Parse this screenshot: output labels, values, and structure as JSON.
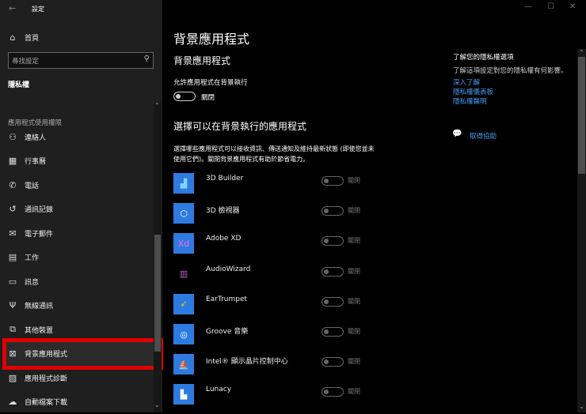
{
  "window": {
    "title": "設定",
    "minimize": "—",
    "maximize": "☐",
    "close": "✕"
  },
  "sidebar": {
    "home": "首頁",
    "search_placeholder": "尋找設定",
    "section": "隱私權",
    "group": "應用程式使用權限",
    "items": [
      {
        "label": "連絡人",
        "icon": "contacts-icon",
        "glyph": "⚇"
      },
      {
        "label": "行事曆",
        "icon": "calendar-icon",
        "glyph": "▦"
      },
      {
        "label": "電話",
        "icon": "phone-icon",
        "glyph": "✆"
      },
      {
        "label": "通訊記錄",
        "icon": "history-icon",
        "glyph": "↺"
      },
      {
        "label": "電子郵件",
        "icon": "mail-icon",
        "glyph": "✉"
      },
      {
        "label": "工作",
        "icon": "clipboard-icon",
        "glyph": "▤"
      },
      {
        "label": "訊息",
        "icon": "message-icon",
        "glyph": "▭"
      },
      {
        "label": "無線通訊",
        "icon": "radio-icon",
        "glyph": "Ψ"
      },
      {
        "label": "其他裝置",
        "icon": "devices-icon",
        "glyph": "⧉"
      },
      {
        "label": "背景應用程式",
        "icon": "background-apps-icon",
        "glyph": "⊠"
      },
      {
        "label": "應用程式診斷",
        "icon": "diagnostics-icon",
        "glyph": "▨"
      },
      {
        "label": "自動檔案下載",
        "icon": "cloud-icon",
        "glyph": "☁"
      }
    ]
  },
  "main": {
    "title": "背景應用程式",
    "subtitle": "背景應用程式",
    "allow_label": "允許應用程式在背景執行",
    "allow_state": "關閉",
    "choose_heading": "選擇可以在背景執行的應用程式",
    "desc1": "選擇哪些應用程式可以接收資訊、傳送通知及維持最新狀態 (即使您並未",
    "desc2": "使用它們)。關閉背景應用程式有助於節省電力。",
    "apps": [
      {
        "name": "3D Builder",
        "state": "關閉",
        "bg": "#2d7be0",
        "glyph": "▟",
        "fg": "#7fd4ff"
      },
      {
        "name": "3D 檢視器",
        "state": "關閉",
        "bg": "#2d7be0",
        "glyph": "⬡",
        "fg": "#fff"
      },
      {
        "name": "Adobe XD",
        "state": "關閉",
        "bg": "#2d7be0",
        "glyph": "Xd",
        "fg": "#ff61f6"
      },
      {
        "name": "AudioWizard",
        "state": "關閉",
        "bg": "transparent",
        "glyph": "▥",
        "fg": "#c060d0"
      },
      {
        "name": "EarTrumpet",
        "state": "關閉",
        "bg": "#2d7be0",
        "glyph": "➶",
        "fg": "#f0c020"
      },
      {
        "name": "Groove 音樂",
        "state": "關閉",
        "bg": "#2d7be0",
        "glyph": "◎",
        "fg": "#fff"
      },
      {
        "name": "Intel® 顯示晶片控制中心",
        "state": "關閉",
        "bg": "#2d7be0",
        "glyph": "⛵",
        "fg": "#fff"
      },
      {
        "name": "Lunacy",
        "state": "關閉",
        "bg": "#2d7be0",
        "glyph": "▙",
        "fg": "#fff"
      }
    ]
  },
  "aside": {
    "heading": "了解您的隱私權選項",
    "text": "了解這項設定對您的隱私權有何影響。",
    "links": [
      "深入了解",
      "隱私權儀表板",
      "隱私權聲明"
    ],
    "help": "取得協助"
  }
}
